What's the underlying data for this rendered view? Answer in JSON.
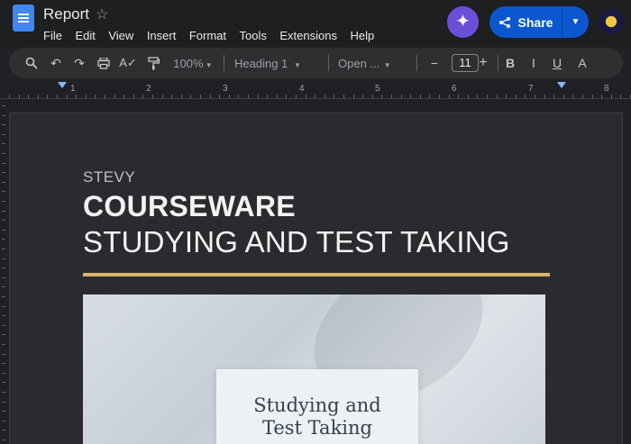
{
  "app": {
    "doc_title": "Report",
    "share_label": "Share"
  },
  "menu": [
    "File",
    "Edit",
    "View",
    "Insert",
    "Format",
    "Tools",
    "Extensions",
    "Help"
  ],
  "toolbar": {
    "zoom": "100%",
    "style": "Heading 1",
    "font": "Open ...",
    "font_size": "11",
    "minus": "−",
    "plus": "+",
    "bold": "B",
    "italic": "I",
    "underline": "U",
    "text_color": "A",
    "icons": [
      "search-icon",
      "undo-icon",
      "redo-icon",
      "print-icon",
      "spellcheck-icon",
      "paint-format-icon"
    ]
  },
  "ruler": {
    "numbers": [
      "1",
      "2",
      "3",
      "4",
      "5",
      "6",
      "7",
      "8"
    ]
  },
  "document": {
    "eyebrow": "STEVY",
    "heading": "COURSEWARE",
    "subheading": "STUDYING AND TEST TAKING",
    "book_title_line1": "Studying and",
    "book_title_line2": "Test Taking"
  },
  "colors": {
    "accent_rule": "#d9b26b",
    "share_button": "#0b57d0",
    "doc_icon": "#4285f4",
    "gemini": "#6b4fd9"
  }
}
